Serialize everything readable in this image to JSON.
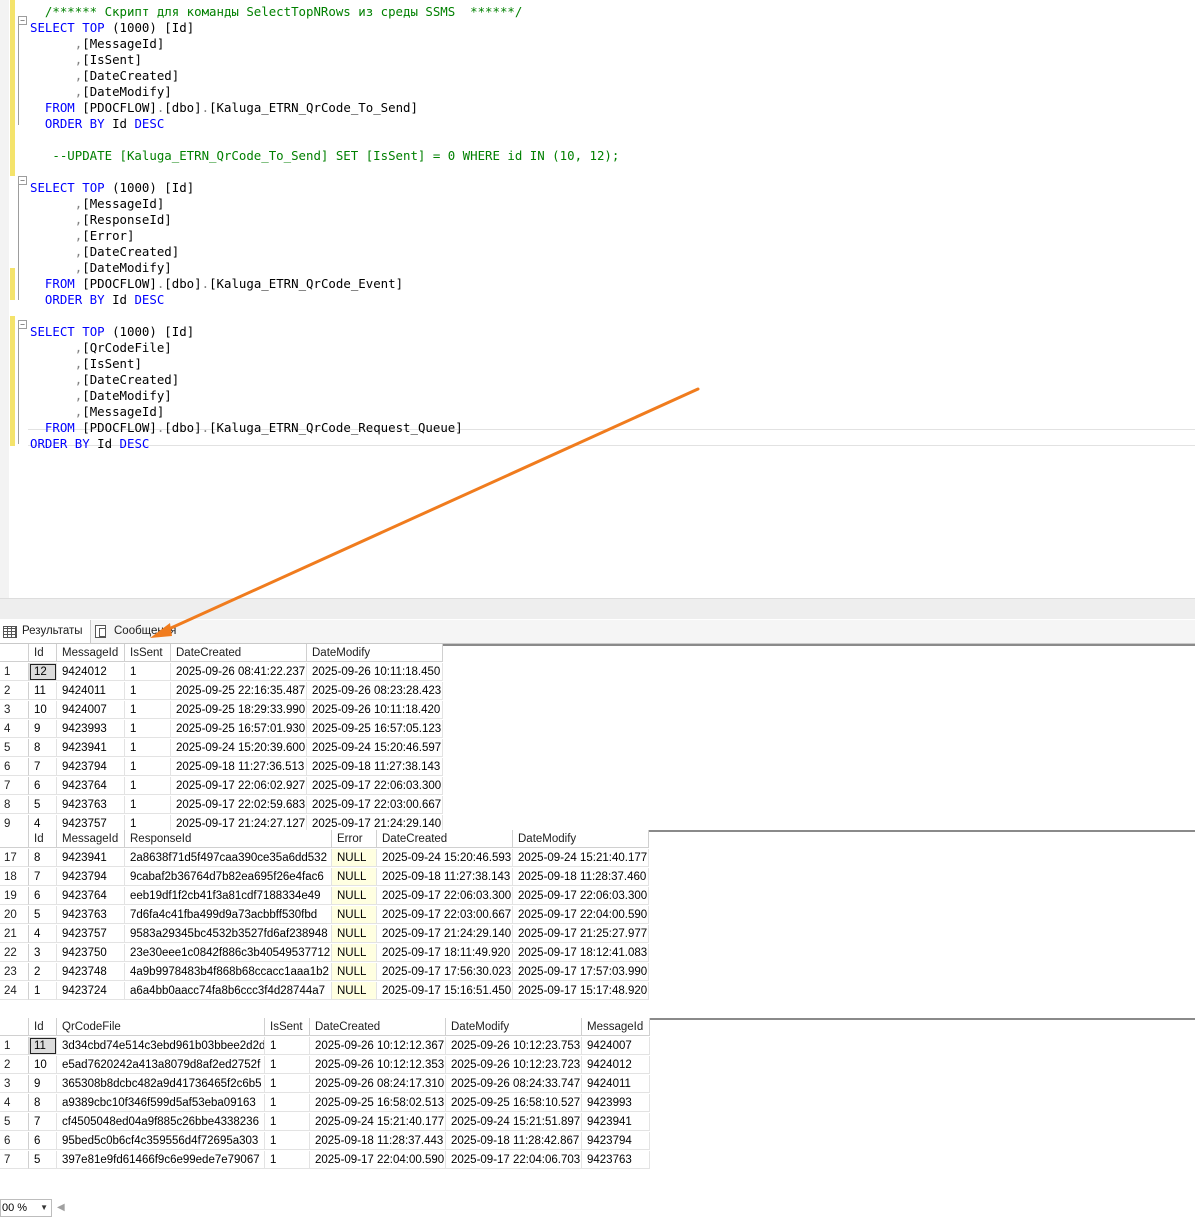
{
  "editor": {
    "lines": [
      [
        {
          "t": "  /****** Скрипт для команды SelectTopNRows из среды SSMS  ******/",
          "c": "cm"
        }
      ],
      [
        {
          "t": "SELECT",
          "c": "kw"
        },
        {
          "t": " "
        },
        {
          "t": "TOP",
          "c": "kw"
        },
        {
          "t": " ("
        },
        {
          "t": "1000"
        },
        {
          "t": ") [Id]"
        }
      ],
      [
        {
          "t": "      ",
          "c": ""
        },
        {
          "t": ",",
          "c": "gy"
        },
        {
          "t": "[MessageId]"
        }
      ],
      [
        {
          "t": "      "
        },
        {
          "t": ",",
          "c": "gy"
        },
        {
          "t": "[IsSent]"
        }
      ],
      [
        {
          "t": "      "
        },
        {
          "t": ",",
          "c": "gy"
        },
        {
          "t": "[DateCreated]"
        }
      ],
      [
        {
          "t": "      "
        },
        {
          "t": ",",
          "c": "gy"
        },
        {
          "t": "[DateModify]"
        }
      ],
      [
        {
          "t": "  "
        },
        {
          "t": "FROM",
          "c": "kw"
        },
        {
          "t": " [PDOCFLOW]"
        },
        {
          "t": ".",
          "c": "gy"
        },
        {
          "t": "[dbo]"
        },
        {
          "t": ".",
          "c": "gy"
        },
        {
          "t": "[Kaluga_ETRN_QrCode_To_Send]"
        }
      ],
      [
        {
          "t": "  "
        },
        {
          "t": "ORDER BY",
          "c": "kw"
        },
        {
          "t": " Id "
        },
        {
          "t": "DESC",
          "c": "kw"
        }
      ],
      [
        {
          "t": ""
        }
      ],
      [
        {
          "t": "   --UPDATE [Kaluga_ETRN_QrCode_To_Send] SET [IsSent] = 0 WHERE id IN (10, 12);",
          "c": "cm"
        }
      ],
      [
        {
          "t": ""
        }
      ],
      [
        {
          "t": "SELECT",
          "c": "kw"
        },
        {
          "t": " "
        },
        {
          "t": "TOP",
          "c": "kw"
        },
        {
          "t": " ("
        },
        {
          "t": "1000"
        },
        {
          "t": ") [Id]"
        }
      ],
      [
        {
          "t": "      "
        },
        {
          "t": ",",
          "c": "gy"
        },
        {
          "t": "[MessageId]"
        }
      ],
      [
        {
          "t": "      "
        },
        {
          "t": ",",
          "c": "gy"
        },
        {
          "t": "[ResponseId]"
        }
      ],
      [
        {
          "t": "      "
        },
        {
          "t": ",",
          "c": "gy"
        },
        {
          "t": "[Error]"
        }
      ],
      [
        {
          "t": "      "
        },
        {
          "t": ",",
          "c": "gy"
        },
        {
          "t": "[DateCreated]"
        }
      ],
      [
        {
          "t": "      "
        },
        {
          "t": ",",
          "c": "gy"
        },
        {
          "t": "[DateModify]"
        }
      ],
      [
        {
          "t": "  "
        },
        {
          "t": "FROM",
          "c": "kw"
        },
        {
          "t": " [PDOCFLOW]"
        },
        {
          "t": ".",
          "c": "gy"
        },
        {
          "t": "[dbo]"
        },
        {
          "t": ".",
          "c": "gy"
        },
        {
          "t": "[Kaluga_ETRN_QrCode_Event]"
        }
      ],
      [
        {
          "t": "  "
        },
        {
          "t": "ORDER BY",
          "c": "kw"
        },
        {
          "t": " Id "
        },
        {
          "t": "DESC",
          "c": "kw"
        }
      ],
      [
        {
          "t": ""
        }
      ],
      [
        {
          "t": "SELECT",
          "c": "kw"
        },
        {
          "t": " "
        },
        {
          "t": "TOP",
          "c": "kw"
        },
        {
          "t": " ("
        },
        {
          "t": "1000"
        },
        {
          "t": ") [Id]"
        }
      ],
      [
        {
          "t": "      "
        },
        {
          "t": ",",
          "c": "gy"
        },
        {
          "t": "[QrCodeFile]"
        }
      ],
      [
        {
          "t": "      "
        },
        {
          "t": ",",
          "c": "gy"
        },
        {
          "t": "[IsSent]"
        }
      ],
      [
        {
          "t": "      "
        },
        {
          "t": ",",
          "c": "gy"
        },
        {
          "t": "[DateCreated]"
        }
      ],
      [
        {
          "t": "      "
        },
        {
          "t": ",",
          "c": "gy"
        },
        {
          "t": "[DateModify]"
        }
      ],
      [
        {
          "t": "      "
        },
        {
          "t": ",",
          "c": "gy"
        },
        {
          "t": "[MessageId]"
        }
      ],
      [
        {
          "t": "  "
        },
        {
          "t": "FROM",
          "c": "kw"
        },
        {
          "t": " [PDOCFLOW]"
        },
        {
          "t": ".",
          "c": "gy"
        },
        {
          "t": "[dbo]"
        },
        {
          "t": ".",
          "c": "gy"
        },
        {
          "t": "[Kaluga_ETRN_QrCode_Request_Queue]"
        }
      ],
      [
        {
          "t": "ORDER BY",
          "c": "kw"
        },
        {
          "t": " Id "
        },
        {
          "t": "DESC",
          "c": "kw"
        }
      ]
    ]
  },
  "zoom": {
    "value": "00 %",
    "arrow": "▼",
    "scroll_left": "◀"
  },
  "tabs": {
    "results": "Результаты",
    "messages": "Сообщения"
  },
  "grid1": {
    "columns": [
      "Id",
      "MessageId",
      "IsSent",
      "DateCreated",
      "DateModify"
    ],
    "rows": [
      [
        "1",
        "12",
        "9424012",
        "1",
        "2025-09-26 08:41:22.237",
        "2025-09-26 10:11:18.450"
      ],
      [
        "2",
        "11",
        "9424011",
        "1",
        "2025-09-25 22:16:35.487",
        "2025-09-26 08:23:28.423"
      ],
      [
        "3",
        "10",
        "9424007",
        "1",
        "2025-09-25 18:29:33.990",
        "2025-09-26 10:11:18.420"
      ],
      [
        "4",
        "9",
        "9423993",
        "1",
        "2025-09-25 16:57:01.930",
        "2025-09-25 16:57:05.123"
      ],
      [
        "5",
        "8",
        "9423941",
        "1",
        "2025-09-24 15:20:39.600",
        "2025-09-24 15:20:46.597"
      ],
      [
        "6",
        "7",
        "9423794",
        "1",
        "2025-09-18 11:27:36.513",
        "2025-09-18 11:27:38.143"
      ],
      [
        "7",
        "6",
        "9423764",
        "1",
        "2025-09-17 22:06:02.927",
        "2025-09-17 22:06:03.300"
      ],
      [
        "8",
        "5",
        "9423763",
        "1",
        "2025-09-17 22:02:59.683",
        "2025-09-17 22:03:00.667"
      ],
      [
        "9",
        "4",
        "9423757",
        "1",
        "2025-09-17 21:24:27.127",
        "2025-09-17 21:24:29.140"
      ]
    ]
  },
  "grid2": {
    "columns": [
      "Id",
      "MessageId",
      "ResponseId",
      "Error",
      "DateCreated",
      "DateModify"
    ],
    "rows": [
      [
        "17",
        "8",
        "9423941",
        "2a8638f71d5f497caa390ce35a6dd532",
        "NULL",
        "2025-09-24 15:20:46.593",
        "2025-09-24 15:21:40.177"
      ],
      [
        "18",
        "7",
        "9423794",
        "9cabaf2b36764d7b82ea695f26e4fac6",
        "NULL",
        "2025-09-18 11:27:38.143",
        "2025-09-18 11:28:37.460"
      ],
      [
        "19",
        "6",
        "9423764",
        "eeb19df1f2cb41f3a81cdf7188334e49",
        "NULL",
        "2025-09-17 22:06:03.300",
        "2025-09-17 22:06:03.300"
      ],
      [
        "20",
        "5",
        "9423763",
        "7d6fa4c41fba499d9a73acbbff530fbd",
        "NULL",
        "2025-09-17 22:03:00.667",
        "2025-09-17 22:04:00.590"
      ],
      [
        "21",
        "4",
        "9423757",
        "9583a29345bc4532b3527fd6af238948",
        "NULL",
        "2025-09-17 21:24:29.140",
        "2025-09-17 21:25:27.977"
      ],
      [
        "22",
        "3",
        "9423750",
        "23e30eee1c0842f886c3b40549537712",
        "NULL",
        "2025-09-17 18:11:49.920",
        "2025-09-17 18:12:41.083"
      ],
      [
        "23",
        "2",
        "9423748",
        "4a9b9978483b4f868b68ccacc1aaa1b2",
        "NULL",
        "2025-09-17 17:56:30.023",
        "2025-09-17 17:57:03.990"
      ],
      [
        "24",
        "1",
        "9423724",
        "a6a4bb0aacc74fa8b6ccc3f4d28744a7",
        "NULL",
        "2025-09-17 15:16:51.450",
        "2025-09-17 15:17:48.920"
      ]
    ]
  },
  "grid3": {
    "columns": [
      "Id",
      "QrCodeFile",
      "IsSent",
      "DateCreated",
      "DateModify",
      "MessageId"
    ],
    "rows": [
      [
        "1",
        "11",
        "3d34cbd74e514c3ebd961b03bbee2d2d",
        "1",
        "2025-09-26 10:12:12.367",
        "2025-09-26 10:12:23.753",
        "9424007"
      ],
      [
        "2",
        "10",
        "e5ad7620242a413a8079d8af2ed2752f",
        "1",
        "2025-09-26 10:12:12.353",
        "2025-09-26 10:12:23.723",
        "9424012"
      ],
      [
        "3",
        "9",
        "365308b8dcbc482a9d41736465f2c6b5",
        "1",
        "2025-09-26 08:24:17.310",
        "2025-09-26 08:24:33.747",
        "9424011"
      ],
      [
        "4",
        "8",
        "a9389cbc10f346f599d5af53eba09163",
        "1",
        "2025-09-25 16:58:02.513",
        "2025-09-25 16:58:10.527",
        "9423993"
      ],
      [
        "5",
        "7",
        "cf4505048ed04a9f885c26bbe4338236",
        "1",
        "2025-09-24 15:21:40.177",
        "2025-09-24 15:21:51.897",
        "9423941"
      ],
      [
        "6",
        "6",
        "95bed5c0b6cf4c359556d4f72695a303",
        "1",
        "2025-09-18 11:28:37.443",
        "2025-09-18 11:28:42.867",
        "9423794"
      ],
      [
        "7",
        "5",
        "397e81e9fd61466f9c6e99ede7e79067",
        "1",
        "2025-09-17 22:04:00.590",
        "2025-09-17 22:04:06.703",
        "9423763"
      ]
    ]
  },
  "colors": {
    "arrow": "#f07c1e",
    "change_margin": "#f4e36b",
    "keyword": "#0000ff",
    "comment": "#008000",
    "null_bg": "#ffffe1"
  }
}
